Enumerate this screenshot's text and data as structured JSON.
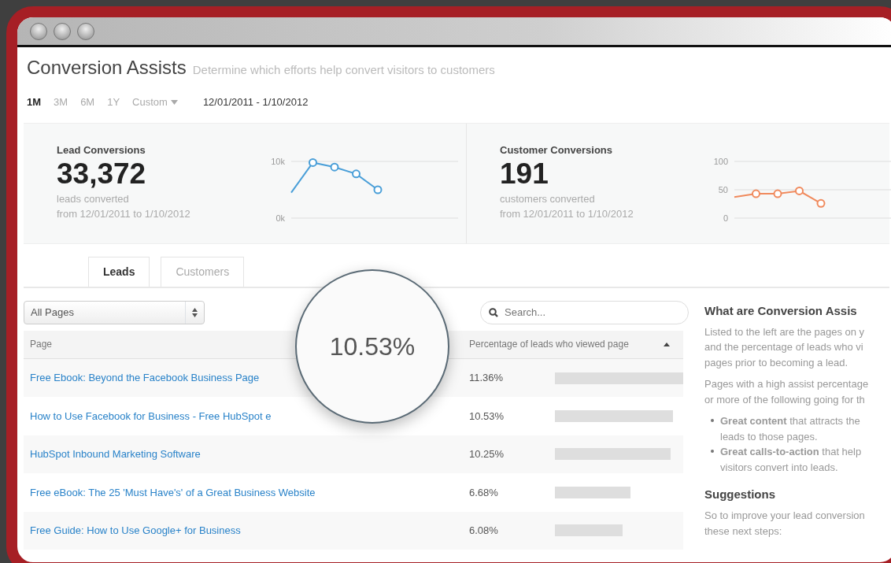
{
  "window": {
    "title": "Conversion Assists",
    "subtitle": "Determine which efforts help convert visitors to customers"
  },
  "ranges": [
    {
      "label": "1M",
      "selected": true
    },
    {
      "label": "3M",
      "selected": false
    },
    {
      "label": "6M",
      "selected": false
    },
    {
      "label": "1Y",
      "selected": false
    }
  ],
  "custom_range": {
    "label": "Custom"
  },
  "date_range": "12/01/2011 - 1/10/2012",
  "stats": [
    {
      "title": "Lead Conversions",
      "value": "33,372",
      "caption": "leads converted",
      "period": "from 12/01/2011 to 1/10/2012",
      "chart_data": {
        "type": "line",
        "series": [
          {
            "color": "#4a9fd8",
            "marker": true,
            "values": [
              4500,
              9800,
              9000,
              7800,
              5000
            ]
          }
        ],
        "ylim": [
          0,
          10000
        ],
        "yticks": [
          {
            "value": 0,
            "label": "0k"
          },
          {
            "value": 10000,
            "label": "10k"
          }
        ]
      }
    },
    {
      "title": "Customer Conversions",
      "value": "191",
      "caption": "customers converted",
      "period": "from 12/01/2011 to 1/10/2012",
      "chart_data": {
        "type": "line",
        "series": [
          {
            "color": "#f08a5d",
            "marker": true,
            "values": [
              37,
              43,
              43,
              48,
              26
            ]
          }
        ],
        "ylim": [
          0,
          100
        ],
        "yticks": [
          0,
          50,
          100
        ]
      }
    }
  ],
  "tabs": [
    {
      "label": "Leads",
      "selected": true
    },
    {
      "label": "Customers",
      "selected": false
    }
  ],
  "filter": {
    "value": "All Pages"
  },
  "search": {
    "placeholder": "Search..."
  },
  "table": {
    "columns": [
      "Page",
      "Percentage of leads who viewed page"
    ],
    "rows": [
      {
        "page": "Free Ebook: Beyond the Facebook Business Page",
        "percent": "11.36%",
        "level": 1.0
      },
      {
        "page": "How to Use Facebook for Business - Free HubSpot e",
        "percent": "10.53%",
        "level": 0.92
      },
      {
        "page": "HubSpot Inbound Marketing Software",
        "percent": "10.25%",
        "level": 0.9
      },
      {
        "page": "Free eBook: The 25 'Must Have's' of a Great Business Website",
        "percent": "6.68%",
        "level": 0.59
      },
      {
        "page": "Free Guide: How to Use Google+ for Business",
        "percent": "6.08%",
        "level": 0.53
      }
    ]
  },
  "magnifier": {
    "text": "10.53%"
  },
  "help": {
    "title": "What are Conversion Assis",
    "paragraphs": [
      "Listed to the left are the pages on y and the percentage of leads who vi pages prior to becoming a lead.",
      "Pages with a high assist percentage or more of the following going for th"
    ],
    "bullets": [
      "**Great content** that attracts the leads to those pages.",
      "**Great calls-to-action** that help visitors convert into leads."
    ],
    "suggestions_title": "Suggestions",
    "suggestions_text": "So to improve your lead conversion these next steps:"
  }
}
